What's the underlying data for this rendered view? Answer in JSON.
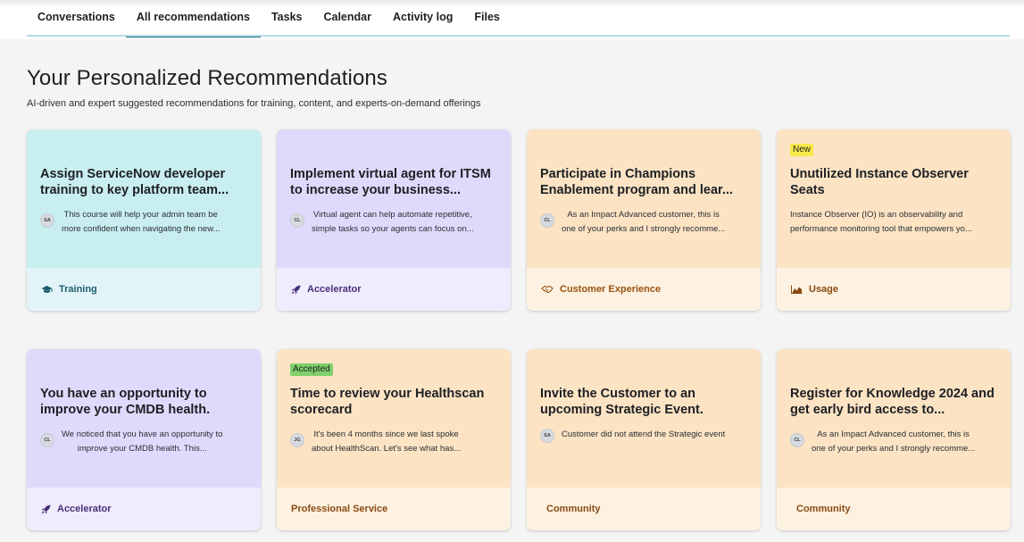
{
  "tabs": [
    {
      "label": "Conversations",
      "active": false
    },
    {
      "label": "All recommendations",
      "active": true
    },
    {
      "label": "Tasks",
      "active": false
    },
    {
      "label": "Calendar",
      "active": false
    },
    {
      "label": "Activity log",
      "active": false
    },
    {
      "label": "Files",
      "active": false
    }
  ],
  "header": {
    "title": "Your Personalized Recommendations",
    "subtitle": "AI-driven and expert suggested recommendations for training, content, and experts-on-demand offerings"
  },
  "colors": {
    "tab_active": "#1c6f84",
    "teal": "#c8eef0",
    "purple": "#e0d9fc",
    "orange": "#fbe3c4",
    "badge_new": "#f7e94a",
    "badge_accepted": "#7fcf6a"
  },
  "cards": [
    {
      "badge": "",
      "title": "Assign ServiceNow developer training to key platform team...",
      "avatar": "SA",
      "desc": "This course will help your admin team be\nmore confident when navigating the new...",
      "category": "Training",
      "icon": "graduation-cap-icon"
    },
    {
      "badge": "",
      "title": "Implement virtual agent for ITSM to increase your business...",
      "avatar": "CL",
      "desc": "Virtual agent can help automate repetitive,\nsimple tasks so your agents can focus on...",
      "category": "Accelerator",
      "icon": "rocket-icon"
    },
    {
      "badge": "",
      "title": "Participate in Champions Enablement program and lear...",
      "avatar": "CL",
      "desc": "As an Impact Advanced customer, this is\none of your perks and I strongly recomme...",
      "category": "Customer Experience",
      "icon": "handshake-icon"
    },
    {
      "badge": "New",
      "title": "Unutilized Instance Observer Seats",
      "avatar": "",
      "desc": "Instance Observer (IO) is an observability and\nperformance monitoring tool that empowers yo...",
      "category": "Usage",
      "icon": "area-chart-icon"
    },
    {
      "badge": "",
      "title": "You have an opportunity to improve your CMDB health.",
      "avatar": "CL",
      "desc": "We noticed that you have an opportunity to\nimprove your CMDB health. This...",
      "category": "Accelerator",
      "icon": "rocket-icon"
    },
    {
      "badge": "Accepted",
      "title": "Time to review your Healthscan scorecard",
      "avatar": "JG",
      "desc": "It's been 4 months since we last spoke\nabout HealthScan. Let's see what has...",
      "category": "Professional Service",
      "icon": ""
    },
    {
      "badge": "",
      "title": "Invite the Customer to an upcoming Strategic Event.",
      "avatar": "SA",
      "desc": "Customer did not attend the Strategic event",
      "category": "Community",
      "icon": ""
    },
    {
      "badge": "",
      "title": "Register for Knowledge 2024 and get early bird access to...",
      "avatar": "CL",
      "desc": "As an Impact Advanced customer, this is\none of your perks and I strongly recomme...",
      "category": "Community",
      "icon": ""
    }
  ]
}
